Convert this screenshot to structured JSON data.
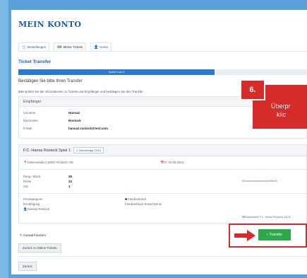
{
  "header": {
    "title": "MEIN KONTO"
  },
  "tabs": [
    {
      "label": "Bestellungen",
      "icon": "cart-icon"
    },
    {
      "label": "Meine Tickets",
      "icon": "ticket-icon"
    },
    {
      "label": "Konto",
      "icon": "user-icon"
    }
  ],
  "section": {
    "title": "Ticket Transfer"
  },
  "progress": {
    "label": "Schritt 3 von 3",
    "value": 0.68
  },
  "confirm": {
    "heading": "Bestätigen Sie bitte Ihren Transfer",
    "hint": "Bitte prüfen Sie die Informationen zu Tickets und Empfänger und bestätigen Sie den Transfer."
  },
  "recipient": {
    "title": "Empfänger",
    "rows": [
      {
        "label": "Vorname",
        "value": "Hansa2"
      },
      {
        "label": "Nachname",
        "value": "Rostock"
      },
      {
        "label": "E-Mail",
        "value": "hansa2.rostock@test.com"
      }
    ]
  },
  "event": {
    "title": "F.C. Hansa Rostock Spiel 1",
    "badge": "2. Bundesliga 23/24",
    "venue": "Ostseestadion 18057 Rostock, DE",
    "date": "Fr. 04.08.2023",
    "rows": [
      {
        "label": "Rang / Block",
        "value": "36"
      },
      {
        "label": "Reihe",
        "value": "22"
      },
      {
        "label": "Sitz",
        "value": "1"
      }
    ],
    "barcode": "00:xxxxxxxxxxxxxxxxxx00x00",
    "price_category_label": "Preiskategorie",
    "price_category_value": "Familienblock",
    "discount_label": "Ermäßigung",
    "discount_value": "Familienblock Erwachsener",
    "holder": "Hansa2 Rostock",
    "season": "Dauerkarte F.C. Hansa Rostock 23/24"
  },
  "actions": {
    "change_selection": "Auswahl ändern",
    "back_to_tickets": "Zurück zu Meine Tickets",
    "back": "Zurück",
    "transfer": "Transfer"
  },
  "callout": {
    "step": "6.",
    "line1": "Überpr",
    "line2": "klic"
  },
  "colors": {
    "accent": "#1a5ea8",
    "highlight": "#d62b2b",
    "confirm": "#2ea94a"
  }
}
